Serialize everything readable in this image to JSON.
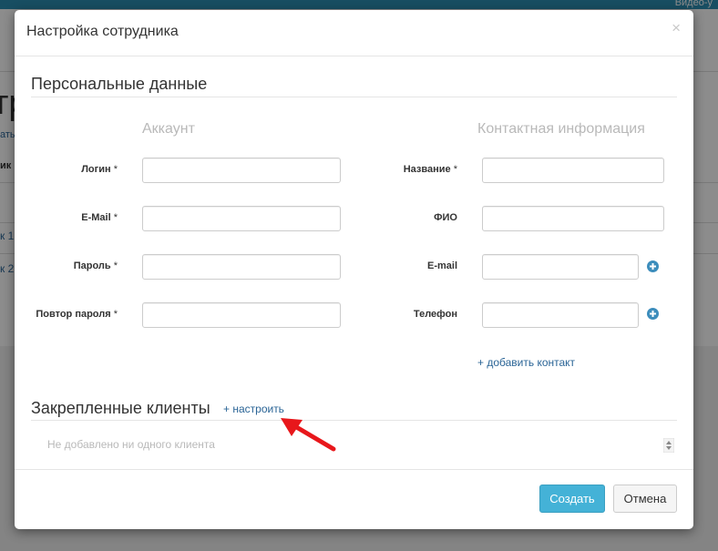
{
  "background": {
    "topbar_text": "Видео-у",
    "heading": "тр",
    "link_text": "ать",
    "bold_text": "ик",
    "row1": "к 1",
    "row2": "к 2"
  },
  "modal": {
    "title": "Настройка сотрудника",
    "close_symbol": "×",
    "personal_section_title": "Персональные данные",
    "account_column_title": "Аккаунт",
    "contact_column_title": "Контактная информация",
    "account_fields": [
      {
        "label": "Логин",
        "required_mark": "*",
        "value": ""
      },
      {
        "label": "E-Mail",
        "required_mark": "*",
        "value": ""
      },
      {
        "label": "Пароль",
        "required_mark": "*",
        "value": ""
      },
      {
        "label": "Повтор пароля",
        "required_mark": "*",
        "value": ""
      }
    ],
    "contact_fields": [
      {
        "label": "Название",
        "required_mark": "*",
        "value": ""
      },
      {
        "label": "ФИО",
        "required_mark": "",
        "value": ""
      },
      {
        "label": "E-mail",
        "required_mark": "",
        "value": ""
      },
      {
        "label": "Телефон",
        "required_mark": "",
        "value": ""
      }
    ],
    "add_contact_link": "+ добавить контакт",
    "clients_section_title": "Закрепленные клиенты",
    "configure_link": "+ настроить",
    "clients_empty_text": "Не добавлено ни одного клиента",
    "create_button": "Создать",
    "cancel_button": "Отмена"
  },
  "colors": {
    "primary_button": "#44b2d7",
    "link": "#2a6496",
    "annotation_arrow": "#e8171b",
    "topbar": "#2d8fb3"
  },
  "icons": {
    "close": "close-icon",
    "add_field": "plus-circle-icon",
    "spinner": "spinner-arrows-icon",
    "annotation": "red-arrow-icon"
  }
}
